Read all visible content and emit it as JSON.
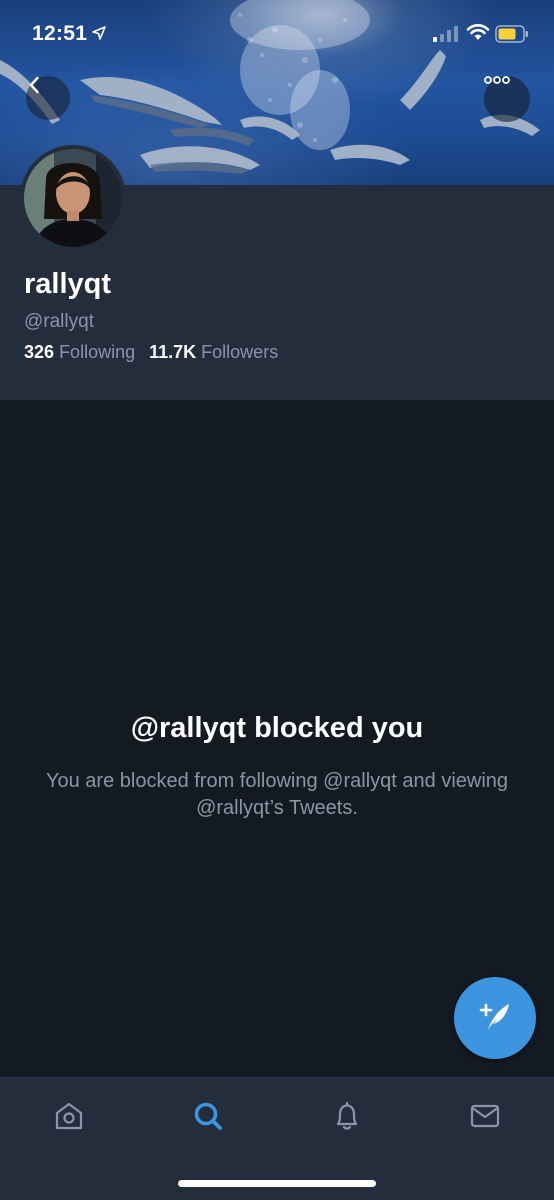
{
  "status_bar": {
    "time": "12:51"
  },
  "header": {
    "back_icon": "chevron-left-icon",
    "more_icon": "more-horizontal-icon"
  },
  "profile": {
    "display_name": "rallyqt",
    "handle": "@rallyqt",
    "following_count": "326",
    "following_label": "Following",
    "followers_count": "11.7K",
    "followers_label": "Followers"
  },
  "blocked": {
    "title": "@rallyqt blocked you",
    "description": "You are blocked from following @rallyqt and viewing @rallyqt’s Tweets."
  },
  "fab": {
    "icon": "compose-tweet-icon"
  },
  "tabbar": {
    "items": [
      {
        "name": "home",
        "icon": "home-icon",
        "active": false
      },
      {
        "name": "search",
        "icon": "search-icon",
        "active": true
      },
      {
        "name": "notifications",
        "icon": "bell-icon",
        "active": false
      },
      {
        "name": "messages",
        "icon": "mail-icon",
        "active": false
      }
    ],
    "active_color": "#3d95e0",
    "inactive_color": "#8a96a6"
  },
  "colors": {
    "background": "#141a22",
    "panel": "#232d3c",
    "accent": "#3d95e0",
    "secondary_text": "#8a96a6"
  }
}
